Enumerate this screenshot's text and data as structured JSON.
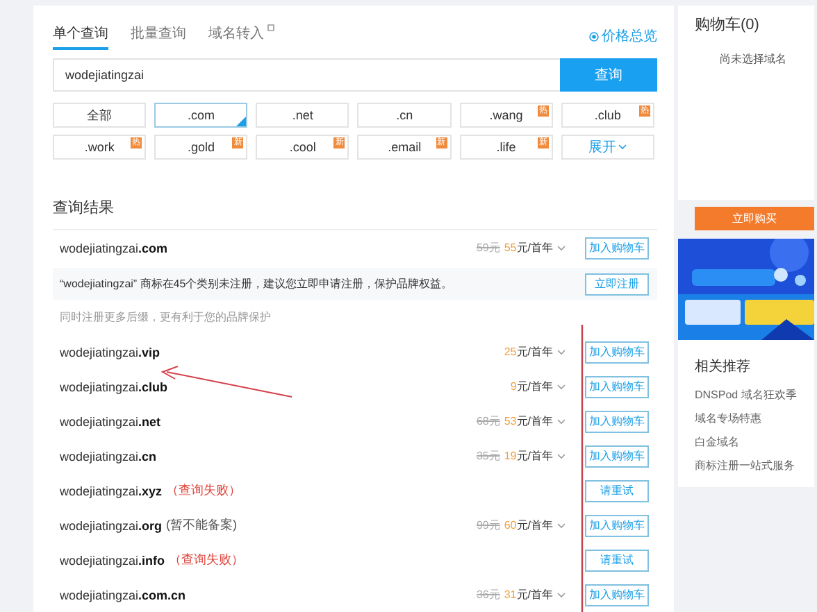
{
  "tabs": [
    {
      "label": "单个查询",
      "selected": true,
      "kind": "plain"
    },
    {
      "label": "批量查询",
      "selected": false,
      "kind": "plain"
    },
    {
      "label": "域名转入",
      "selected": false,
      "kind": "external"
    }
  ],
  "price_overview_link": "价格总览",
  "search": {
    "value": "wodejiatingzai",
    "button": "查询"
  },
  "tlds": [
    {
      "label": "全部",
      "selected": false,
      "kind": "suffix"
    },
    {
      "label": ".com",
      "selected": true,
      "kind": "suffix"
    },
    {
      "label": ".net",
      "selected": false,
      "kind": "suffix"
    },
    {
      "label": ".cn",
      "selected": false,
      "kind": "suffix"
    },
    {
      "label": ".wang",
      "selected": false,
      "kind": "suffix",
      "badge": "热"
    },
    {
      "label": ".club",
      "selected": false,
      "kind": "suffix",
      "badge": "热"
    },
    {
      "label": ".work",
      "selected": false,
      "kind": "suffix",
      "badge": "热"
    },
    {
      "label": ".gold",
      "selected": false,
      "kind": "suffix",
      "badge": "新"
    },
    {
      "label": ".cool",
      "selected": false,
      "kind": "suffix",
      "badge": "新"
    },
    {
      "label": ".email",
      "selected": false,
      "kind": "suffix",
      "badge": "新"
    },
    {
      "label": ".life",
      "selected": false,
      "kind": "suffix",
      "badge": "新"
    },
    {
      "label": "展开",
      "selected": false,
      "kind": "expand"
    }
  ],
  "results_title": "查询结果",
  "results": [
    {
      "kind": "domain",
      "name": "wodejiatingzai**.com**",
      "old_price": "59元",
      "price": "55",
      "unit": "元/首年",
      "button": "加入购物车"
    },
    {
      "kind": "trademark",
      "text": "“wodejiatingzai” 商标在45个类别未注册，建议您立即申请注册，保护品牌权益。",
      "button": "立即注册"
    },
    {
      "kind": "hint",
      "text": "同时注册更多后缀，更有利于您的品牌保护"
    },
    {
      "kind": "domain",
      "name": "wodejiatingzai**.vip**",
      "price": "25",
      "unit": "元/首年",
      "button": "加入购物车"
    },
    {
      "kind": "domain",
      "name": "wodejiatingzai**.club**",
      "price": "9",
      "unit": "元/首年",
      "button": "加入购物车"
    },
    {
      "kind": "domain",
      "name": "wodejiatingzai**.net**",
      "old_price": "68元",
      "price": "53",
      "unit": "元/首年",
      "button": "加入购物车"
    },
    {
      "kind": "domain",
      "name": "wodejiatingzai**.cn**",
      "old_price": "35元",
      "price": "19",
      "unit": "元/首年",
      "button": "加入购物车"
    },
    {
      "kind": "domain",
      "name": "wodejiatingzai**.xyz**",
      "note": "（查询失败）",
      "note_error": true,
      "button": "请重试"
    },
    {
      "kind": "domain",
      "name": "wodejiatingzai**.org**",
      "note": "(暂不能备案)",
      "note_error": false,
      "old_price": "99元",
      "price": "60",
      "unit": "元/首年",
      "button": "加入购物车"
    },
    {
      "kind": "domain",
      "name": "wodejiatingzai**.info**",
      "note": "（查询失败）",
      "note_error": true,
      "button": "请重试"
    },
    {
      "kind": "domain",
      "name": "wodejiatingzai**.com.cn**",
      "old_price": "36元",
      "price": "31",
      "unit": "元/首年",
      "button": "加入购物车"
    }
  ],
  "cart": {
    "title": "购物车(0)",
    "empty": "尚未选择域名",
    "buy_button": "立即购买"
  },
  "related": {
    "title": "相关推荐",
    "links": [
      "DNSPod 域名狂欢季",
      "域名专场特惠",
      "白金域名",
      "商标注册一站式服务"
    ]
  }
}
